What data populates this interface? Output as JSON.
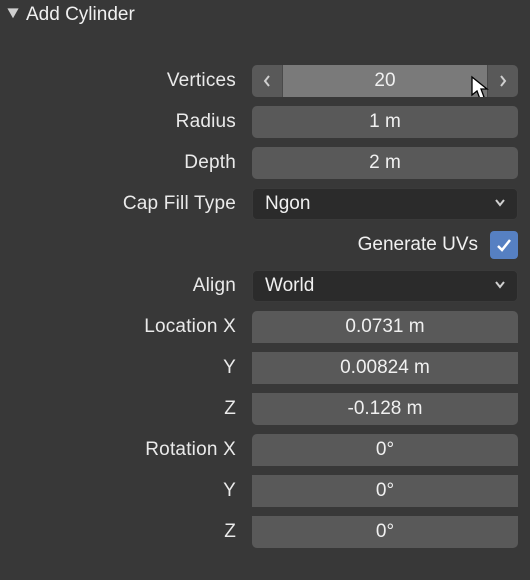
{
  "panel": {
    "title": "Add Cylinder"
  },
  "fields": {
    "vertices": {
      "label": "Vertices",
      "value": "20"
    },
    "radius": {
      "label": "Radius",
      "value": "1 m"
    },
    "depth": {
      "label": "Depth",
      "value": "2 m"
    },
    "capfill": {
      "label": "Cap Fill Type",
      "value": "Ngon"
    },
    "genuvs": {
      "label": "Generate UVs",
      "checked": true
    },
    "align": {
      "label": "Align",
      "value": "World"
    },
    "locx": {
      "label": "Location X",
      "value": "0.0731 m"
    },
    "locy": {
      "label": "Y",
      "value": "0.00824 m"
    },
    "locz": {
      "label": "Z",
      "value": "-0.128 m"
    },
    "rotx": {
      "label": "Rotation X",
      "value": "0°"
    },
    "roty": {
      "label": "Y",
      "value": "0°"
    },
    "rotz": {
      "label": "Z",
      "value": "0°"
    }
  }
}
